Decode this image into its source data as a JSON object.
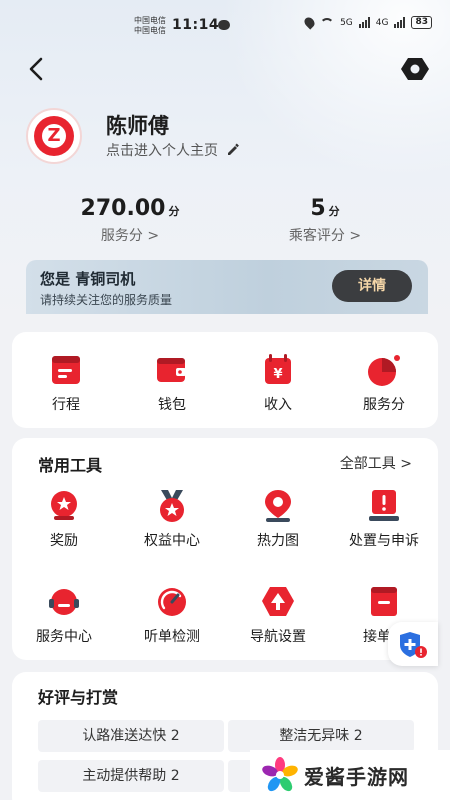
{
  "status_bar": {
    "carrier_1": "中国电信",
    "carrier_2": "中国电信",
    "time": "11:14",
    "net_1": "5G",
    "net_2": "4G",
    "battery": "83"
  },
  "profile": {
    "avatar_letter": "Z",
    "name": "陈师傅",
    "link_text": "点击进入个人主页"
  },
  "stats": [
    {
      "value": "270.00",
      "unit": "分",
      "label": "服务分 >"
    },
    {
      "value": "5",
      "unit": "分",
      "label": "乘客评分 >"
    }
  ],
  "level_banner": {
    "title": "您是 青铜司机",
    "subtitle": "请持续关注您的服务质量",
    "button": "详情"
  },
  "quick_actions": [
    {
      "label": "行程",
      "icon": "itinerary-icon"
    },
    {
      "label": "钱包",
      "icon": "wallet-icon"
    },
    {
      "label": "收入",
      "icon": "income-icon"
    },
    {
      "label": "服务分",
      "icon": "service-score-icon"
    }
  ],
  "tools": {
    "title": "常用工具",
    "more": "全部工具 >",
    "items": [
      {
        "label": "奖励",
        "icon": "reward-icon"
      },
      {
        "label": "权益中心",
        "icon": "benefits-icon"
      },
      {
        "label": "热力图",
        "icon": "heatmap-icon"
      },
      {
        "label": "处置与申诉",
        "icon": "appeal-icon"
      },
      {
        "label": "服务中心",
        "icon": "service-center-icon"
      },
      {
        "label": "听单检测",
        "icon": "order-detection-icon"
      },
      {
        "label": "导航设置",
        "icon": "navigation-settings-icon"
      },
      {
        "label": "接单手",
        "icon": "order-taking-icon"
      }
    ]
  },
  "reviews": {
    "title": "好评与打赏",
    "tags": [
      "认路准送达快 2",
      "整洁无异味 2",
      "主动提供帮助 2"
    ]
  },
  "watermark": {
    "text": "爱酱手游网"
  },
  "colors": {
    "brand_red": "#e8242f",
    "gold_text": "#f4d6a8",
    "banner": "#c9d7e2"
  }
}
